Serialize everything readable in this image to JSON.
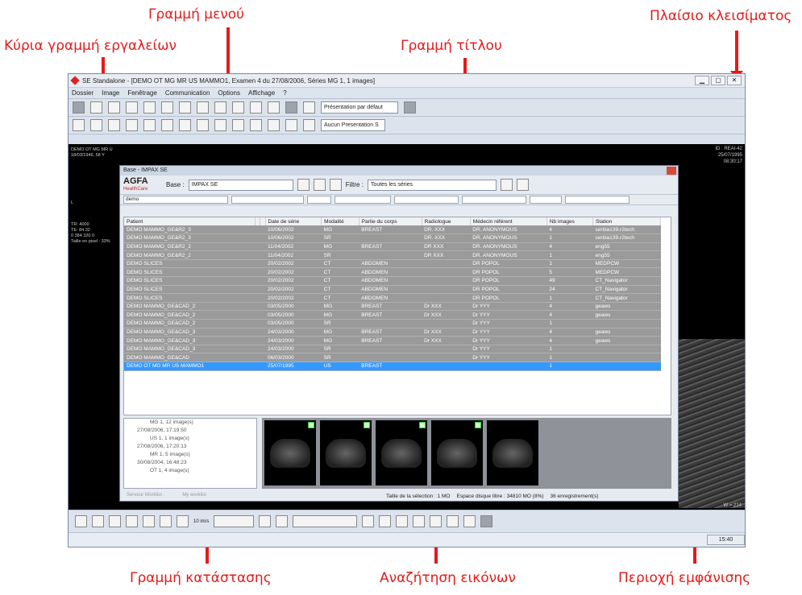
{
  "annotations": {
    "menu_bar": "Γραμμή μενού",
    "close_box": "Πλαίσιο κλεισίματος",
    "main_toolbar": "Κύρια γραμμή εργαλείων",
    "title_bar": "Γραμμή τίτλου",
    "status_bar": "Γραμμή κατάστασης",
    "image_search": "Αναζήτηση εικόνων",
    "display_area": "Περιοχή εμφάνισης"
  },
  "window": {
    "title": "SE Standalone - [DEMO OT MG MR US MAMMO1, Examen 4 du 27/08/2006, Séries MG 1, 1 images]"
  },
  "menu": [
    "Dossier",
    "Image",
    "Fenêtrage",
    "Communication",
    "Options",
    "Affichage",
    "?"
  ],
  "toolbar": {
    "presentation": "Présentation par défaut",
    "no_presentation": "Aucun Presentation S"
  },
  "viewer": {
    "left_info": [
      "DEMO OT MG MR U",
      "18/03/1946, 58 Y",
      "L",
      "TR: 4000",
      "TE: 84.32",
      "0 384 320 0",
      "Taille en pixel : 33%"
    ],
    "right_info": [
      "ID : REAI-42",
      "25/07/1995",
      "08:30:17"
    ],
    "us_info": "W = 214"
  },
  "dialog": {
    "title": "Base - IMPAX SE",
    "logo": "AGFA",
    "logo_sub": "HealthCare",
    "base_label": "Base :",
    "base_value": "IMPAX SE",
    "filter_label": "Filtre :",
    "filter_value": "Toutes les séries",
    "search": "demo",
    "columns": [
      "Patient",
      "",
      "",
      "Date de série",
      "Modalité",
      "Partie du corps",
      "Radiologue",
      "Médecin référent",
      "Nb images",
      "Station"
    ],
    "rows": [
      [
        "DEMO MAMMO_GE&R2_3",
        "10/06/2002",
        "MG",
        "BREAST",
        "DR. XXX",
        "DR. ANONYMOUS",
        "4",
        "serbia139.r2tech"
      ],
      [
        "DEMO MAMMO_GE&R2_3",
        "10/06/2002",
        "SR",
        "",
        "DR. XXX",
        "DR. ANONYMOUS",
        "1",
        "serbia139.r2tech"
      ],
      [
        "DEMO MAMMO_GE&R2_2",
        "11/04/2002",
        "MG",
        "BREAST",
        "DR XXX",
        "DR. ANONYMOUS",
        "4",
        "eng55"
      ],
      [
        "DEMO MAMMO_GE&R2_2",
        "11/04/2002",
        "SR",
        "",
        "DR XXX",
        "DR. ANONYMOUS",
        "1",
        "eng55"
      ],
      [
        "DEMO SLICES",
        "20/02/2002",
        "CT",
        "ABDOMEN",
        "",
        "DR POPOL",
        "1",
        "MEDPCW"
      ],
      [
        "DEMO SLICES",
        "20/02/2002",
        "CT",
        "ABDOMEN",
        "",
        "DR POPOL",
        "5",
        "MEDPCW"
      ],
      [
        "DEMO SLICES",
        "20/02/2002",
        "CT",
        "ABDOMEN",
        "",
        "DR POPOL",
        "49",
        "CT_Navigator"
      ],
      [
        "DEMO SLICES",
        "20/02/2002",
        "CT",
        "ABDOMEN",
        "",
        "DR POPOL",
        "24",
        "CT_Navigator"
      ],
      [
        "DEMO SLICES",
        "20/02/2002",
        "CT",
        "ABDOMEN",
        "",
        "DR POPOL",
        "1",
        "CT_Navigator"
      ],
      [
        "DEMO MAMMO_GE&CAD_2",
        "03/05/2000",
        "MG",
        "BREAST",
        "Dr XXX",
        "Dr YYY",
        "4",
        "geaws"
      ],
      [
        "DEMO MAMMO_GE&CAD_2",
        "03/05/2000",
        "MG",
        "BREAST",
        "Dr XXX",
        "Dr YYY",
        "4",
        "geaws"
      ],
      [
        "DEMO MAMMO_GE&CAD_2",
        "03/05/2000",
        "SR",
        "",
        "",
        "Dr YYY",
        "1",
        ""
      ],
      [
        "DEMO MAMMO_GE&CAD_3",
        "24/03/2000",
        "MG",
        "BREAST",
        "Dr XXX",
        "Dr YYY",
        "4",
        "geaws"
      ],
      [
        "DEMO MAMMO_GE&CAD_3",
        "24/03/2000",
        "MG",
        "BREAST",
        "Dr XXX",
        "Dr YYY",
        "4",
        "geaws"
      ],
      [
        "DEMO MAMMO_GE&CAD_3",
        "24/03/2000",
        "SR",
        "",
        "",
        "Dr YYY",
        "1",
        ""
      ],
      [
        "DEMO MAMMO_GE&CAD",
        "06/03/2000",
        "SR",
        "",
        "",
        "Dr YYY",
        "1",
        ""
      ],
      [
        "DEMO OT MG MR US MAMMO1",
        "25/07/1995",
        "US",
        "BREAST",
        "",
        "",
        "1",
        ""
      ]
    ],
    "tree": [
      "MG 1, 12 image(s)",
      "27/08/2006, 17:19:50",
      "US 1, 1 image(s)",
      "27/08/2006, 17:20:13",
      "MR 1, 5 image(s)",
      "30/08/2004, 16:48:23",
      "OT 1, 4 image(s)"
    ],
    "worklist": [
      "Serveur Worklist :",
      "My worklist"
    ],
    "status": [
      "Taille de la sélection : 1 MO",
      "Espace disque libre : 34810 MO (8%)",
      "36 enregistrement(s)"
    ]
  },
  "bottom": {
    "speed": "10 im/s"
  },
  "statusbar": {
    "time": "15:40"
  }
}
